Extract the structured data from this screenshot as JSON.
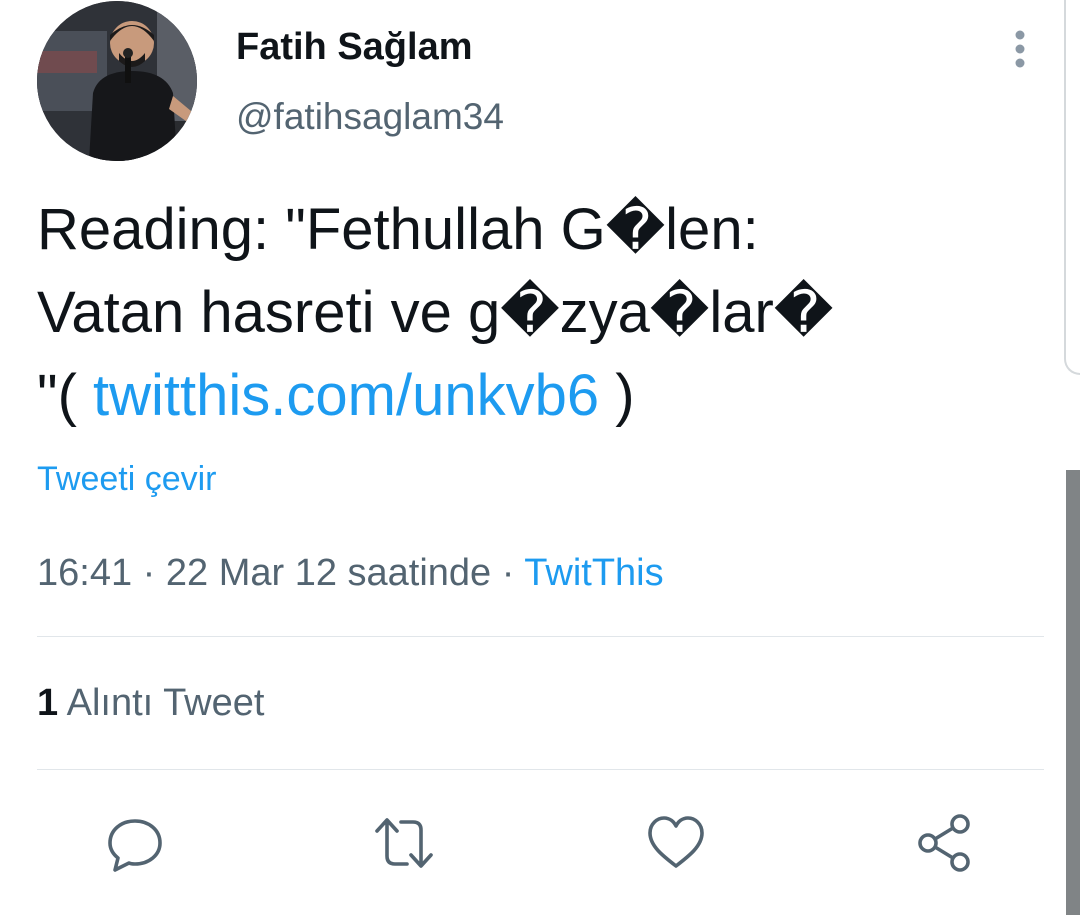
{
  "user": {
    "display_name": "Fatih Sağlam",
    "handle": "@fatihsaglam34"
  },
  "tweet": {
    "text_line1": "Reading: \"Fethullah G�len:",
    "text_line2": "Vatan hasreti ve g�zya�lar�",
    "text_line3_prefix": "\"( ",
    "link": "twitthis.com/unkvb6",
    "text_line3_suffix": " )"
  },
  "translate_label": "Tweeti çevir",
  "meta": {
    "time_date": "16:41 · 22 Mar 12 saatinde · ",
    "source": "TwitThis"
  },
  "stats": {
    "quote_count": "1",
    "quote_label": " Alıntı Tweet"
  },
  "icons": {
    "more": "more-vertical-icon",
    "reply": "reply-icon",
    "retweet": "retweet-icon",
    "like": "heart-icon",
    "share": "share-icon"
  },
  "colors": {
    "link": "#1d9bf0",
    "secondary_text": "#536471",
    "primary_text": "#0f1419",
    "divider": "#e1e6ea"
  }
}
